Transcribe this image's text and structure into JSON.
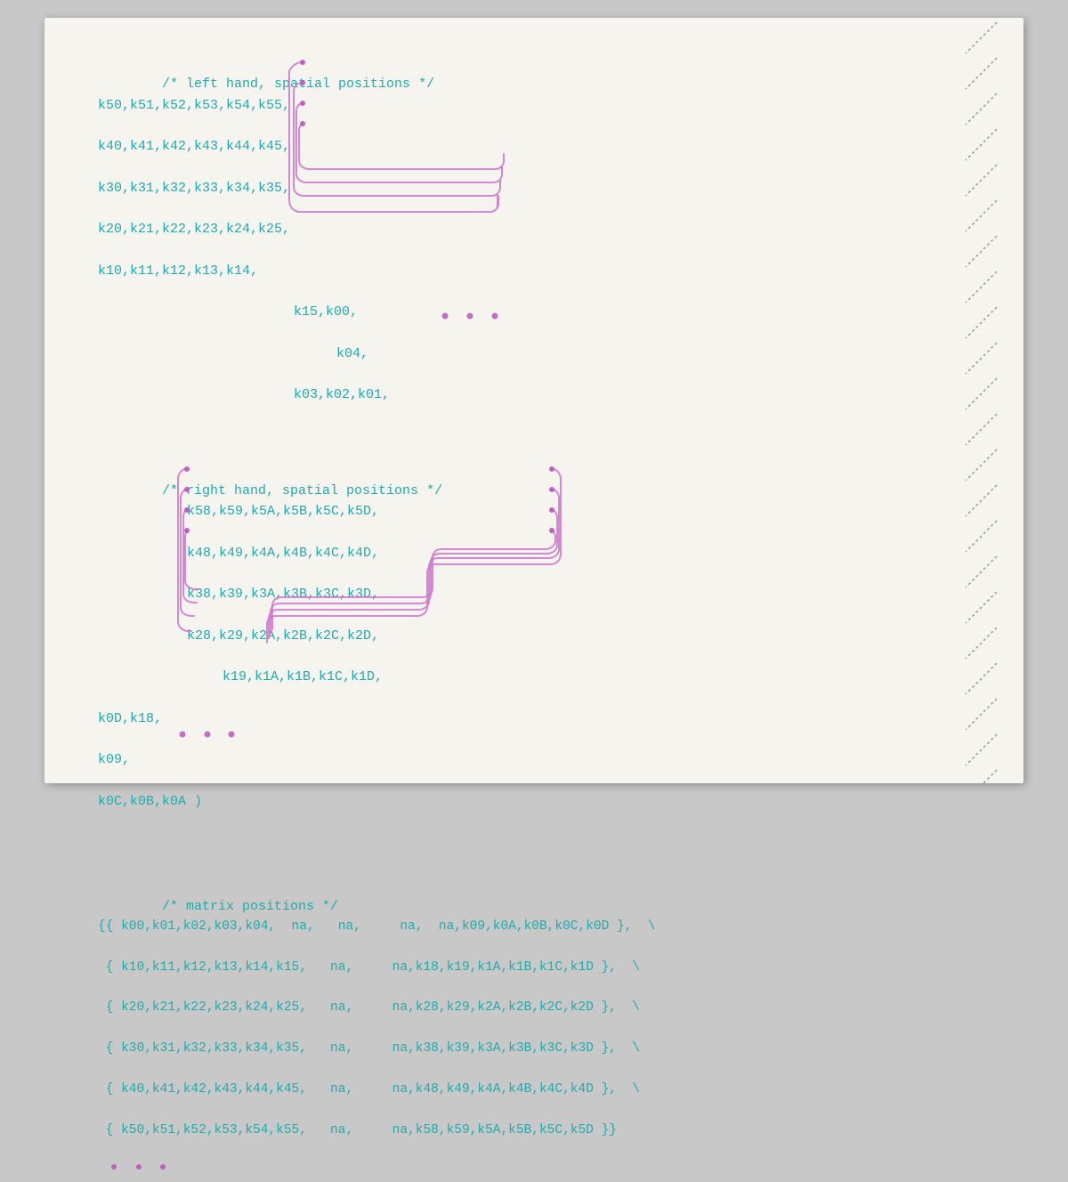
{
  "page": {
    "background": "#f5f4ef",
    "sections": {
      "left_hand": {
        "comment": "/* left hand, spatial positions */",
        "lines": [
          "k50,k51,k52,k53,k54,k55,",
          "k40,k41,k42,k43,k44,k45,",
          "k30,k31,k32,k33,k34,k35,",
          "k20,k21,k22,k23,k24,k25,",
          "k10,k11,k12,k13,k14,",
          "                    k15,k00,",
          "                        k04,",
          "                    k03,k02,k01,"
        ]
      },
      "right_hand": {
        "comment": "/* right hand, spatial positions */",
        "lines": [
          "        k58,k59,k5A,k5B,k5C,k5D,",
          "        k48,k49,k4A,k4B,k4C,k4D,",
          "        k38,k39,k3A,k3B,k3C,k3D,",
          "        k28,k29,k2A,k2B,k2C,k2D,",
          "             k19,k1A,k1B,k1C,k1D,",
          "k0D,k18,",
          "k09,",
          "k0C,k0B,k0A )"
        ]
      },
      "matrix": {
        "comment": "/* matrix positions */",
        "lines": [
          "{{ k00,k01,k02,k03,k04, na,  na,    na, na,k09,k0A,k0B,k0C,k0D },  \\",
          " { k10,k11,k12,k13,k14,k15,  na,    na,k18,k19,k1A,k1B,k1C,k1D },  \\",
          " { k20,k21,k22,k23,k24,k25,  na,    na,k28,k29,k2A,k2B,k2C,k2D },  \\",
          " { k30,k31,k32,k33,k34,k35,  na,    na,k38,k39,k3A,k3B,k3C,k3D },  \\",
          " { k40,k41,k42,k43,k44,k45,  na,    na,k48,k49,k4A,k4B,k4C,k4D },  \\",
          " { k50,k51,k52,k53,k54,k55,  na,    na,k58,k59,k5A,k5B,k5C,k5D }}"
        ]
      }
    }
  }
}
